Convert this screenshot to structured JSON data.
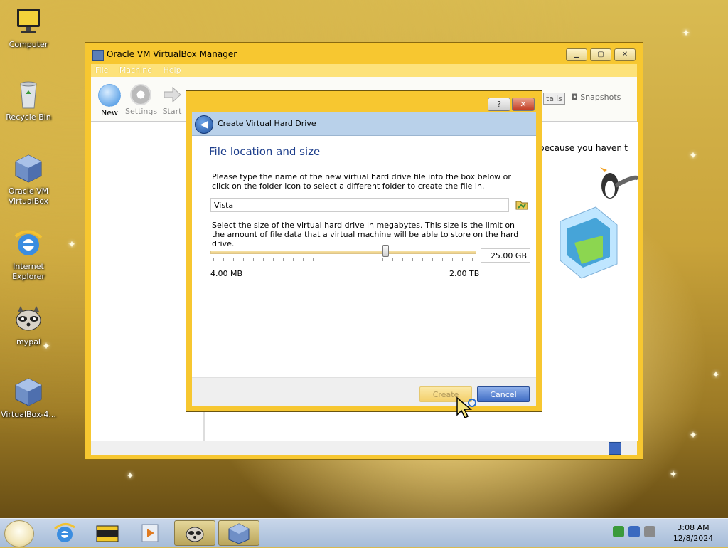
{
  "desktop": {
    "icons": [
      {
        "label": "Computer"
      },
      {
        "label": "Recycle Bin"
      },
      {
        "label": "Oracle VM VirtualBox"
      },
      {
        "label": "Internet Explorer"
      },
      {
        "label": "mypal"
      },
      {
        "label": "VirtualBox-4..."
      }
    ]
  },
  "main_window": {
    "title": "Oracle VM VirtualBox Manager",
    "menu": [
      "File",
      "Machine",
      "Help"
    ],
    "toolbar": [
      {
        "label": "New",
        "icon": "new-icon"
      },
      {
        "label": "Settings",
        "icon": "gear-icon"
      },
      {
        "label": "Start",
        "icon": "arrow-right-icon"
      }
    ],
    "tabs": {
      "details": "tails",
      "snapshots": "Snapshots"
    },
    "welcome_fragment": "because you haven't"
  },
  "dialog": {
    "title": "Create Virtual Hard Drive",
    "help_btn": "?",
    "close_btn": "✕",
    "heading": "File location and size",
    "location_desc": "Please type the name of the new virtual hard drive file into the box below or click on the folder icon to select a different folder to create the file in.",
    "location_value": "Vista",
    "size_desc": "Select the size of the virtual hard drive in megabytes. This size is the limit on the amount of file data that a virtual machine will be able to store on the hard drive.",
    "size_value": "25.00 GB",
    "slider_position": 0.66,
    "min_label": "4.00 MB",
    "max_label": "2.00 TB",
    "create_btn": "Create",
    "cancel_btn": "Cancel"
  },
  "taskbar": {
    "time": "3:08 AM",
    "date": "12/8/2024"
  },
  "colors": {
    "window_frame": "#f7c730",
    "dialog_header": "#b9d1ea",
    "heading_text": "#1e3f8c",
    "cancel_button": "#3e6bc4"
  }
}
